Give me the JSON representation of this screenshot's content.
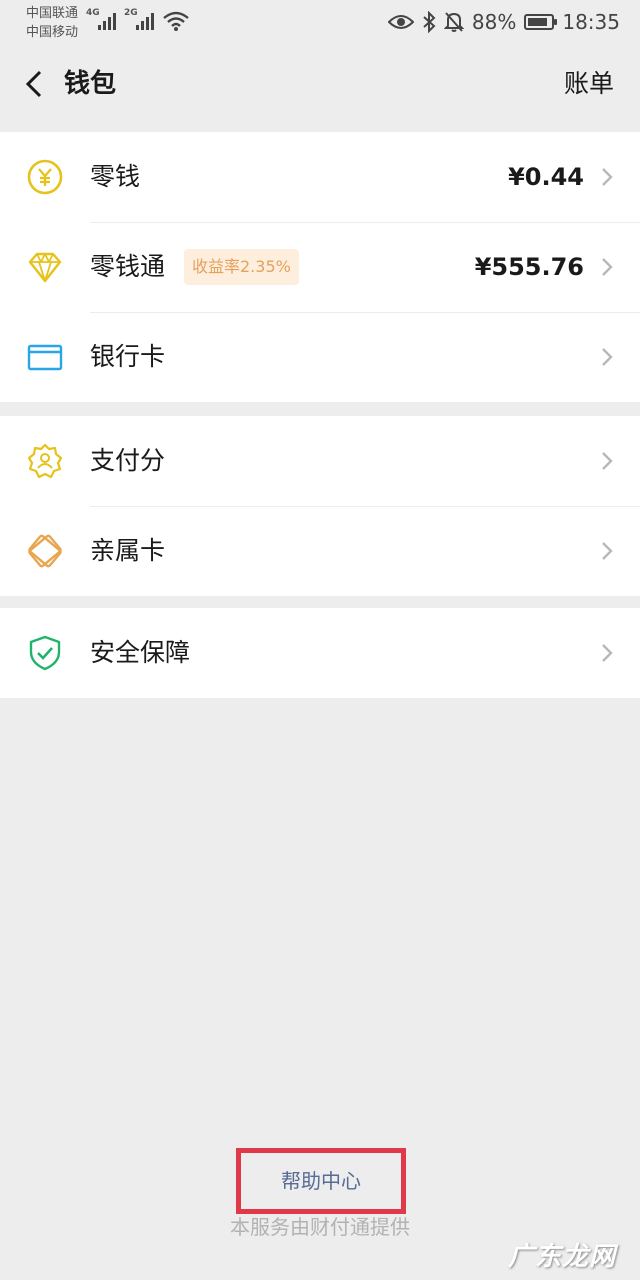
{
  "status_bar": {
    "carrier1": "中国联通",
    "carrier2": "中国移动",
    "net1": "4G",
    "net2": "2G",
    "battery": "88%",
    "battery_level": 0.88,
    "time": "18:35"
  },
  "nav": {
    "title": "钱包",
    "right": "账单"
  },
  "groups": [
    {
      "items": [
        {
          "label": "零钱",
          "value": "¥0.44",
          "icon": "yuan-coin-icon"
        },
        {
          "label": "零钱通",
          "badge": "收益率2.35%",
          "value": "¥555.76",
          "icon": "diamond-icon"
        },
        {
          "label": "银行卡",
          "icon": "bank-card-icon"
        }
      ]
    },
    {
      "items": [
        {
          "label": "支付分",
          "icon": "pay-score-icon"
        },
        {
          "label": "亲属卡",
          "icon": "family-card-icon"
        }
      ]
    },
    {
      "items": [
        {
          "label": "安全保障",
          "icon": "shield-check-icon"
        }
      ]
    }
  ],
  "footer": {
    "help": "帮助中心",
    "provider": "本服务由财付通提供"
  },
  "watermark": "广东龙网",
  "colors": {
    "background": "#ededed",
    "gold": "#e6c21a",
    "card_blue": "#2aa6e8",
    "orange": "#e9a64f",
    "green": "#21b36b",
    "link": "#576b95",
    "highlight": "#e03a4a"
  }
}
